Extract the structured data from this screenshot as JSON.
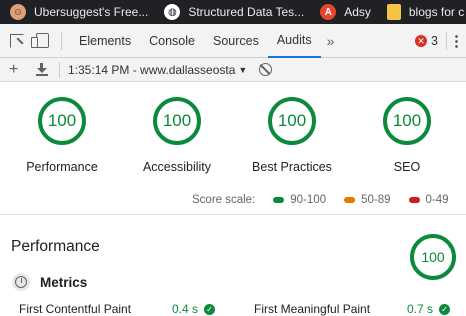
{
  "bookmarks": [
    {
      "label": "Ubersuggest's Free...",
      "icon": "face-icon"
    },
    {
      "label": "Structured Data Tes...",
      "icon": "globe-icon"
    },
    {
      "label": "Adsy",
      "icon": "adsy-icon"
    },
    {
      "label": "blogs for c",
      "icon": "folder-icon"
    }
  ],
  "devtools": {
    "tabs": [
      "Elements",
      "Console",
      "Sources",
      "Audits"
    ],
    "active_tab": "Audits",
    "more": "»",
    "error_count": "3"
  },
  "toolbar": {
    "report_selector": "1:35:14 PM - www.dallasseosta"
  },
  "categories": [
    {
      "label": "Performance",
      "score": "100"
    },
    {
      "label": "Accessibility",
      "score": "100"
    },
    {
      "label": "Best Practices",
      "score": "100"
    },
    {
      "label": "SEO",
      "score": "100"
    }
  ],
  "score_scale": {
    "label": "Score scale:",
    "ranges": [
      {
        "label": "90-100",
        "color": "#0c8a3b"
      },
      {
        "label": "50-89",
        "color": "#e67700"
      },
      {
        "label": "0-49",
        "color": "#cc1f1f"
      }
    ]
  },
  "section": {
    "title": "Performance",
    "score": "100",
    "metrics_heading": "Metrics"
  },
  "metrics": [
    {
      "label": "First Contentful Paint",
      "value": "0.4 s"
    },
    {
      "label": "First Meaningful Paint",
      "value": "0.7 s"
    }
  ],
  "colors": {
    "pass": "#0c8a3b",
    "accent": "#1a73e8"
  }
}
